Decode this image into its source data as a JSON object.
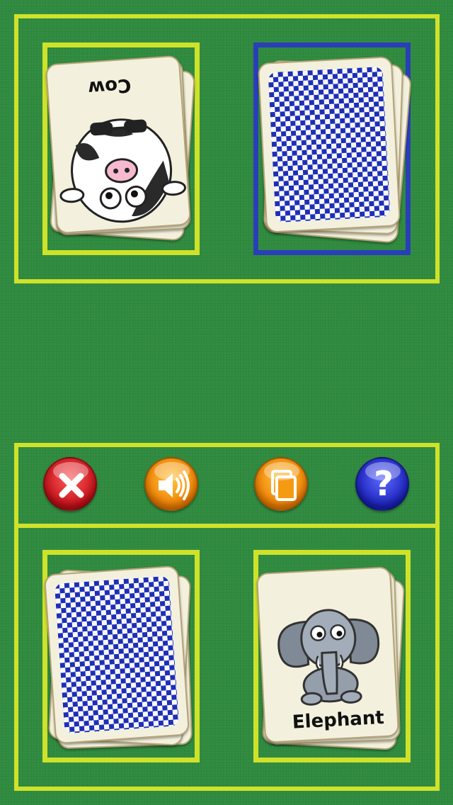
{
  "top_pile": {
    "face_card": {
      "label": "Cow",
      "animal": "cow-illustration",
      "orientation": "upside-down"
    },
    "draw_pile": {
      "face": "card-back",
      "selected": true
    }
  },
  "toolbar": {
    "buttons": [
      {
        "name": "close-button",
        "icon": "close-icon",
        "color": "#c30f17"
      },
      {
        "name": "sound-button",
        "icon": "speaker-icon",
        "color": "#ee7d00"
      },
      {
        "name": "cards-button",
        "icon": "cards-icon",
        "color": "#ee7d00"
      },
      {
        "name": "help-button",
        "icon": "question-icon",
        "color": "#1a20b8",
        "glyph": "?"
      }
    ]
  },
  "bottom_pile": {
    "draw_pile": {
      "face": "card-back"
    },
    "face_card": {
      "label": "Elephant",
      "animal": "elephant-illustration"
    }
  },
  "colors": {
    "table": "#2f8a3f",
    "frame": "#cfe22a",
    "selected_frame": "#2a3eb8",
    "card_back": "#1e2fb6"
  }
}
